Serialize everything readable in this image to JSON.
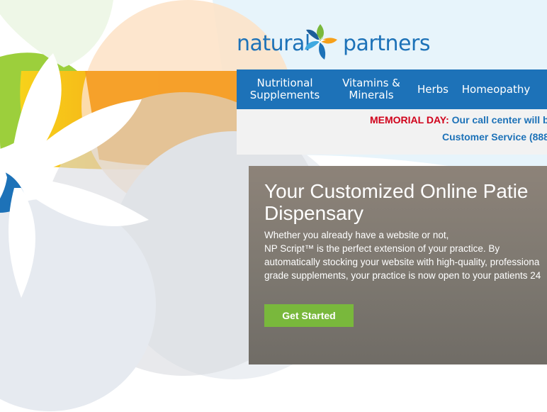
{
  "brand": {
    "name_left": "natural",
    "name_right": "partners",
    "logo_icon": "flower-logo-icon",
    "colors": {
      "primary": "#1d72b8",
      "accent_green": "#79b83c",
      "alert": "#d0021b"
    }
  },
  "nav": {
    "items": [
      {
        "label": "Nutritional\nSupplements"
      },
      {
        "label": "Vitamins &\nMinerals"
      },
      {
        "label": "Herbs"
      },
      {
        "label": "Homeopathy"
      }
    ]
  },
  "notice": {
    "prefix": "MEMORIAL DAY:",
    "message": "Our call center will b",
    "contact": "Customer Service (888"
  },
  "hero": {
    "title_line1": "Your Customized Online Patie",
    "title_line2": "Dispensary",
    "body_lines": [
      "Whether you already have a website or not,",
      "NP Script™ is the perfect extension of your practice. By",
      "automatically stocking your website with high-quality, professiona",
      "grade supplements, your practice is now open to your patients 24"
    ],
    "cta_label": "Get Started"
  }
}
